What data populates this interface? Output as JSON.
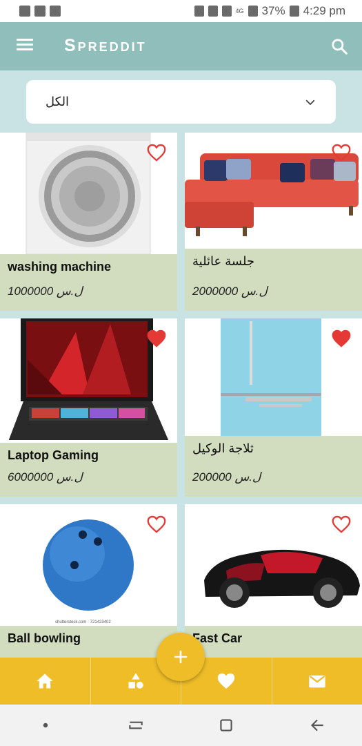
{
  "status_bar": {
    "battery": "37%",
    "time": "4:29 pm",
    "network": "4G"
  },
  "app_bar": {
    "title": "Spreddit",
    "menu_icon": "hamburger-menu-icon",
    "search_icon": "search-icon"
  },
  "filter": {
    "selected": "الكل",
    "icon": "chevron-down-icon"
  },
  "products": [
    {
      "name": "washing machine",
      "price": "ل.س 1000000",
      "favorite": false,
      "image": "washing-machine"
    },
    {
      "name": "جلسة عائلية",
      "price": "ل.س 2000000",
      "favorite": false,
      "image": "red-sofa"
    },
    {
      "name": "Laptop Gaming",
      "price": "ل.س 6000000",
      "favorite": true,
      "image": "gaming-laptop"
    },
    {
      "name": "ثلاجة الوكيل",
      "price": "ل.س 200000",
      "favorite": true,
      "image": "blue-fridge"
    },
    {
      "name": "Ball bowling",
      "price": "",
      "favorite": false,
      "image": "bowling-ball",
      "image_caption": "shutterstock.com · 721423402"
    },
    {
      "name": "Fast Car",
      "price": "",
      "favorite": false,
      "image": "sports-car"
    }
  ],
  "bottom_nav": {
    "items": [
      {
        "icon": "home-icon"
      },
      {
        "icon": "categories-icon"
      },
      {
        "icon": "heart-icon"
      },
      {
        "icon": "mail-icon"
      }
    ],
    "fab_icon": "plus-icon"
  },
  "colors": {
    "app_bar": "#90bfbb",
    "background": "#c9e3e4",
    "card_info": "#d2dcbf",
    "bottom_nav": "#eebd28",
    "heart": "#e53935"
  }
}
